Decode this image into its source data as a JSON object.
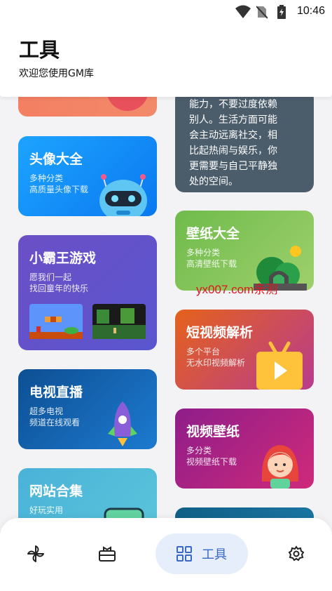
{
  "status_bar": {
    "time": "10:46",
    "icons": [
      "wifi-icon",
      "no-sim-icon",
      "battery-charging-icon"
    ]
  },
  "header": {
    "title": "工具",
    "subtitle": "欢迎您使用GM库"
  },
  "left_cards": [
    {
      "title": "头像大全",
      "lines": [
        "多种分类",
        "高质量头像下载"
      ],
      "color_from": "#1da4ff",
      "color_to": "#0a78f0",
      "art": "robot-icon"
    },
    {
      "title": "小霸王游戏",
      "lines": [
        "愿我们一起",
        "找回童年的快乐"
      ],
      "color_from": "#6b4fc6",
      "color_to": "#5a56cf",
      "art": "game-screens"
    },
    {
      "title": "电视直播",
      "lines": [
        "超多电视",
        "频道在线观看"
      ],
      "color_from": "#0d4f93",
      "color_to": "#1d7ad0",
      "art": "rocket-icon"
    },
    {
      "title": "网站合集",
      "lines": [
        "好玩实用"
      ],
      "color_from": "#4ab2d8",
      "color_to": "#5bc6dc",
      "art": "monitor-icon"
    }
  ],
  "right_cards": [
    {
      "title": "壁纸大全",
      "lines": [
        "多种分类",
        "高清壁纸下载"
      ],
      "color_from": "#6fbb4c",
      "color_to": "#9ed06b",
      "art": "landscape-icon"
    },
    {
      "title": "短视频解析",
      "lines": [
        "多个平台",
        "无水印视频解析"
      ],
      "color_from": "#e5621b",
      "color_to": "#b83c8e",
      "art": "video-play-icon"
    },
    {
      "title": "视频壁纸",
      "lines": [
        "多分类",
        "视频壁纸下载"
      ],
      "color_from": "#8e1d8a",
      "color_to": "#cf2a7a",
      "art": "girl-avatar-icon"
    }
  ],
  "note_card": {
    "lines": [
      "能力，不要过度依赖",
      "别人。生活方面可能",
      "会主动远离社交，相",
      "比起热闹与娱乐，你",
      "更需要与自己平静独",
      "处的空间。"
    ]
  },
  "watermark": "yx007.com亲测",
  "bottom_nav": {
    "items": [
      {
        "icon": "pinwheel-icon"
      },
      {
        "icon": "gift-box-icon"
      },
      {
        "icon": "grid-apps-icon",
        "label": "工具",
        "active": true
      },
      {
        "icon": "gear-icon"
      }
    ]
  },
  "colors": {
    "accent": "#3a68c6",
    "active_bg": "#e6eefb",
    "note_bg": "#4b5c6b"
  }
}
